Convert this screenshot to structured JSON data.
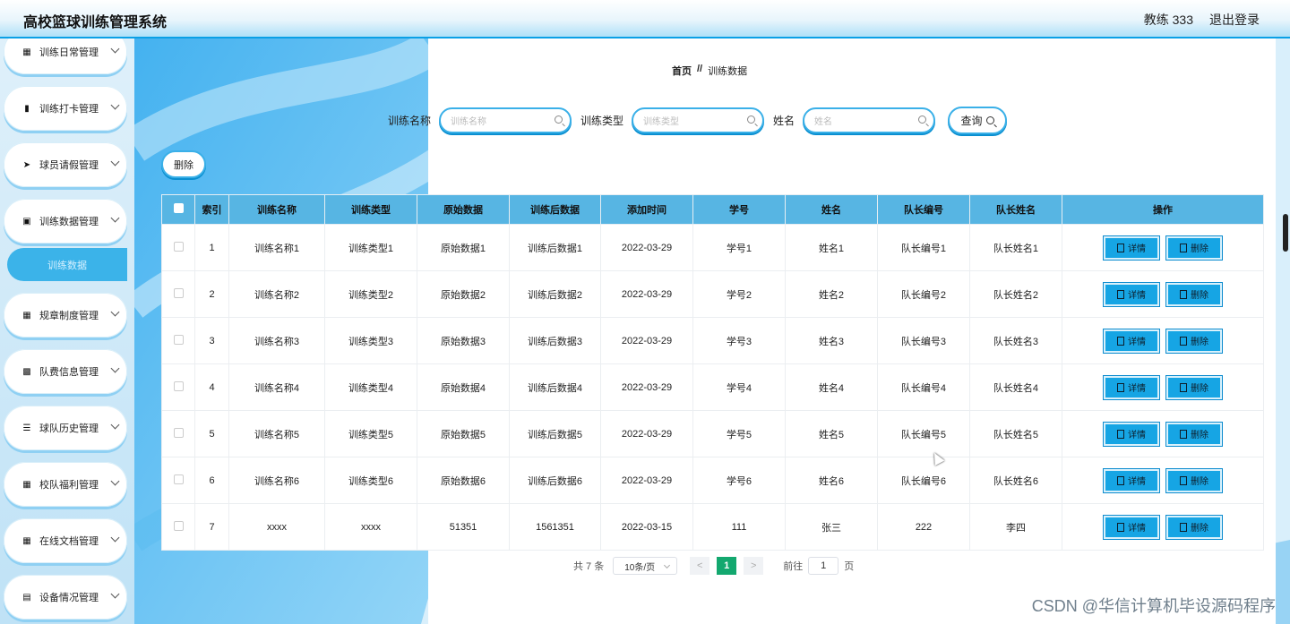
{
  "header": {
    "app_title": "高校篮球训练管理系统",
    "user": "教练 333",
    "logout": "退出登录"
  },
  "sidebar": {
    "items": [
      {
        "label": "训练日常管理",
        "icon": "grid-icon"
      },
      {
        "label": "训练打卡管理",
        "icon": "bar-chart-icon"
      },
      {
        "label": "球员请假管理",
        "icon": "send-icon"
      },
      {
        "label": "训练数据管理",
        "icon": "clipboard-icon"
      },
      {
        "label": "规章制度管理",
        "icon": "grid-icon"
      },
      {
        "label": "队费信息管理",
        "icon": "document-x-icon"
      },
      {
        "label": "球队历史管理",
        "icon": "sliders-icon"
      },
      {
        "label": "校队福利管理",
        "icon": "grid-icon"
      },
      {
        "label": "在线文档管理",
        "icon": "apps-icon"
      },
      {
        "label": "设备情况管理",
        "icon": "document-icon"
      }
    ],
    "active_sub": "训练数据"
  },
  "breadcrumb": {
    "home": "首页",
    "sep": "//",
    "current": "训练数据"
  },
  "search": {
    "name_label": "训练名称",
    "name_placeholder": "训练名称",
    "type_label": "训练类型",
    "type_placeholder": "训练类型",
    "person_label": "姓名",
    "person_placeholder": "姓名",
    "query_label": "查询"
  },
  "delete_label": "删除",
  "table": {
    "headers": [
      "索引",
      "训练名称",
      "训练类型",
      "原始数据",
      "训练后数据",
      "添加时间",
      "学号",
      "姓名",
      "队长编号",
      "队长姓名",
      "操作"
    ],
    "rows": [
      {
        "idx": "1",
        "name": "训练名称1",
        "type": "训练类型1",
        "raw": "原始数据1",
        "after": "训练后数据1",
        "date": "2022-03-29",
        "sid": "学号1",
        "person": "姓名1",
        "cap_id": "队长编号1",
        "cap_name": "队长姓名1"
      },
      {
        "idx": "2",
        "name": "训练名称2",
        "type": "训练类型2",
        "raw": "原始数据2",
        "after": "训练后数据2",
        "date": "2022-03-29",
        "sid": "学号2",
        "person": "姓名2",
        "cap_id": "队长编号2",
        "cap_name": "队长姓名2"
      },
      {
        "idx": "3",
        "name": "训练名称3",
        "type": "训练类型3",
        "raw": "原始数据3",
        "after": "训练后数据3",
        "date": "2022-03-29",
        "sid": "学号3",
        "person": "姓名3",
        "cap_id": "队长编号3",
        "cap_name": "队长姓名3"
      },
      {
        "idx": "4",
        "name": "训练名称4",
        "type": "训练类型4",
        "raw": "原始数据4",
        "after": "训练后数据4",
        "date": "2022-03-29",
        "sid": "学号4",
        "person": "姓名4",
        "cap_id": "队长编号4",
        "cap_name": "队长姓名4"
      },
      {
        "idx": "5",
        "name": "训练名称5",
        "type": "训练类型5",
        "raw": "原始数据5",
        "after": "训练后数据5",
        "date": "2022-03-29",
        "sid": "学号5",
        "person": "姓名5",
        "cap_id": "队长编号5",
        "cap_name": "队长姓名5"
      },
      {
        "idx": "6",
        "name": "训练名称6",
        "type": "训练类型6",
        "raw": "原始数据6",
        "after": "训练后数据6",
        "date": "2022-03-29",
        "sid": "学号6",
        "person": "姓名6",
        "cap_id": "队长编号6",
        "cap_name": "队长姓名6"
      },
      {
        "idx": "7",
        "name": "xxxx",
        "type": "xxxx",
        "raw": "51351",
        "after": "1561351",
        "date": "2022-03-15",
        "sid": "111",
        "person": "张三",
        "cap_id": "222",
        "cap_name": "李四"
      }
    ],
    "detail_label": "详情",
    "delete_label": "删除"
  },
  "pager": {
    "total": "共 7 条",
    "page_size": "10条/页",
    "prev": "<",
    "current": "1",
    "next": ">",
    "goto": "前往",
    "goto_value": "1",
    "page_unit": "页"
  },
  "watermark": "CSDN @华信计算机毕设源码程序",
  "colors": {
    "accent": "#3ab0e8",
    "header_row": "#57b5e3",
    "button": "#16a5e4",
    "pager_active": "#13a86f"
  }
}
